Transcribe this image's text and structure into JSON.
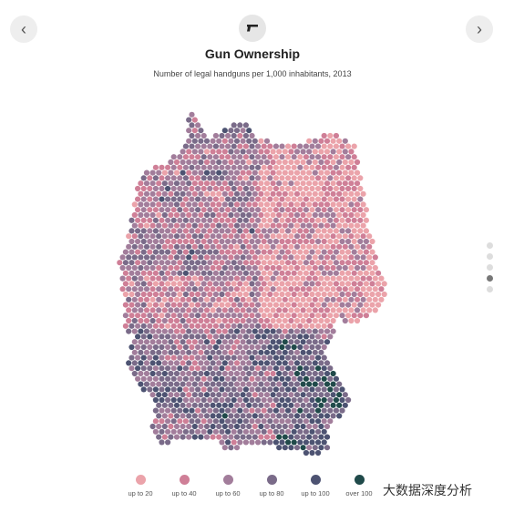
{
  "nav": {
    "prev_icon": "chevron-left-icon",
    "next_icon": "chevron-right-icon",
    "prev_label": "‹",
    "next_label": "›"
  },
  "header": {
    "icon": "handgun-icon",
    "title": "Gun Ownership",
    "subtitle": "Number of legal handguns per 1,000 inhabitants, 2013"
  },
  "pager": {
    "count": 5,
    "active": 4
  },
  "legend": [
    {
      "label": "up to 20",
      "color": "#eba3aa"
    },
    {
      "label": "up to 40",
      "color": "#cf7f97"
    },
    {
      "label": "up to 60",
      "color": "#a27d9b"
    },
    {
      "label": "up to 80",
      "color": "#7a6b89"
    },
    {
      "label": "up to 100",
      "color": "#4d5372"
    },
    {
      "label": "over 100",
      "color": "#204a4a"
    }
  ],
  "watermark": "大数据深度分析"
}
